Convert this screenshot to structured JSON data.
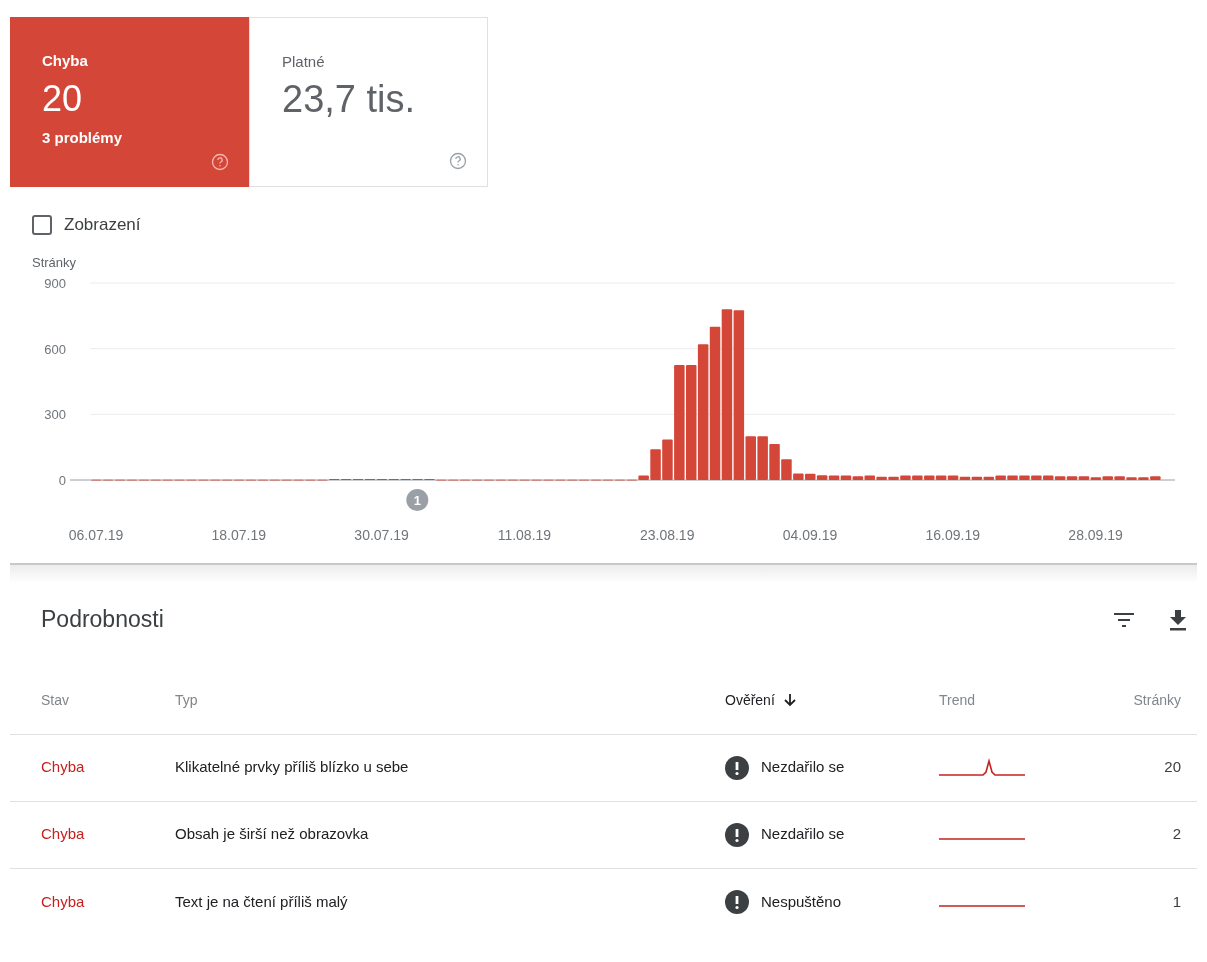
{
  "summary_cards": [
    {
      "kind": "error",
      "selected": true,
      "label": "Chyba",
      "value": "20",
      "subtitle": "3 problémy"
    },
    {
      "kind": "valid",
      "selected": false,
      "label": "Platné",
      "value": "23,7 tis."
    }
  ],
  "impressions_toggle": {
    "label": "Zobrazení",
    "checked": false
  },
  "chart": {
    "chart_data": {
      "type": "bar",
      "ylabel": "Stránky",
      "yticks": [
        0,
        300,
        600,
        900
      ],
      "ylim": [
        0,
        900
      ],
      "categories": [
        "06.07.19",
        null,
        null,
        null,
        null,
        null,
        null,
        null,
        null,
        null,
        null,
        null,
        "18.07.19",
        null,
        null,
        null,
        null,
        null,
        null,
        null,
        null,
        null,
        null,
        null,
        "30.07.19",
        null,
        null,
        null,
        null,
        null,
        null,
        null,
        null,
        null,
        null,
        null,
        "11.08.19",
        null,
        null,
        null,
        null,
        null,
        null,
        null,
        null,
        null,
        null,
        null,
        "23.08.19",
        null,
        null,
        null,
        null,
        null,
        null,
        null,
        null,
        null,
        null,
        null,
        "04.09.19",
        null,
        null,
        null,
        null,
        null,
        null,
        null,
        null,
        null,
        null,
        null,
        "16.09.19",
        null,
        null,
        null,
        null,
        null,
        null,
        null,
        null,
        null,
        null,
        null,
        "28.09.19",
        null,
        null,
        null,
        null,
        null
      ],
      "series": [
        {
          "color": "#d44638",
          "values": [
            1,
            1,
            1,
            1,
            1,
            1,
            1,
            1,
            1,
            1,
            1,
            1,
            1,
            1,
            1,
            1,
            1,
            1,
            1,
            1,
            5,
            5,
            5,
            5,
            5,
            5,
            5,
            5,
            5,
            1,
            1,
            1,
            1,
            1,
            1,
            1,
            1,
            1,
            1,
            1,
            1,
            1,
            1,
            1,
            1,
            1,
            20,
            140,
            185,
            525,
            525,
            620,
            700,
            780,
            775,
            200,
            200,
            165,
            95,
            30,
            28,
            22,
            20,
            20,
            17,
            20,
            15,
            15,
            20,
            20,
            20,
            20,
            20,
            15,
            15,
            15,
            20,
            20,
            20,
            20,
            20,
            17,
            17,
            17,
            12,
            17,
            17,
            12,
            12,
            17
          ]
        }
      ],
      "annotations": [
        "1"
      ]
    }
  },
  "details": {
    "title": "Podrobnosti",
    "columns": [
      {
        "label": "Stav",
        "sorted": false
      },
      {
        "label": "Typ",
        "sorted": false
      },
      {
        "label": "Ověření",
        "sorted": true
      },
      {
        "label": "Trend",
        "sorted": false
      },
      {
        "label": "Stránky",
        "sorted": false
      }
    ],
    "rows": [
      {
        "status": "Chyba",
        "type": "Klikatelné prvky příliš blízko u sebe",
        "validation": "Nezdařilo se",
        "trend": {
          "kind": "peak"
        },
        "pages": "20"
      },
      {
        "status": "Chyba",
        "type": "Obsah je širší než obrazovka",
        "validation": "Nezdařilo se",
        "trend": {
          "kind": "flat"
        },
        "pages": "2"
      },
      {
        "status": "Chyba",
        "type": "Text je na čtení příliš malý",
        "validation": "Nespuštěno",
        "trend": {
          "kind": "flat"
        },
        "pages": "1"
      }
    ]
  }
}
